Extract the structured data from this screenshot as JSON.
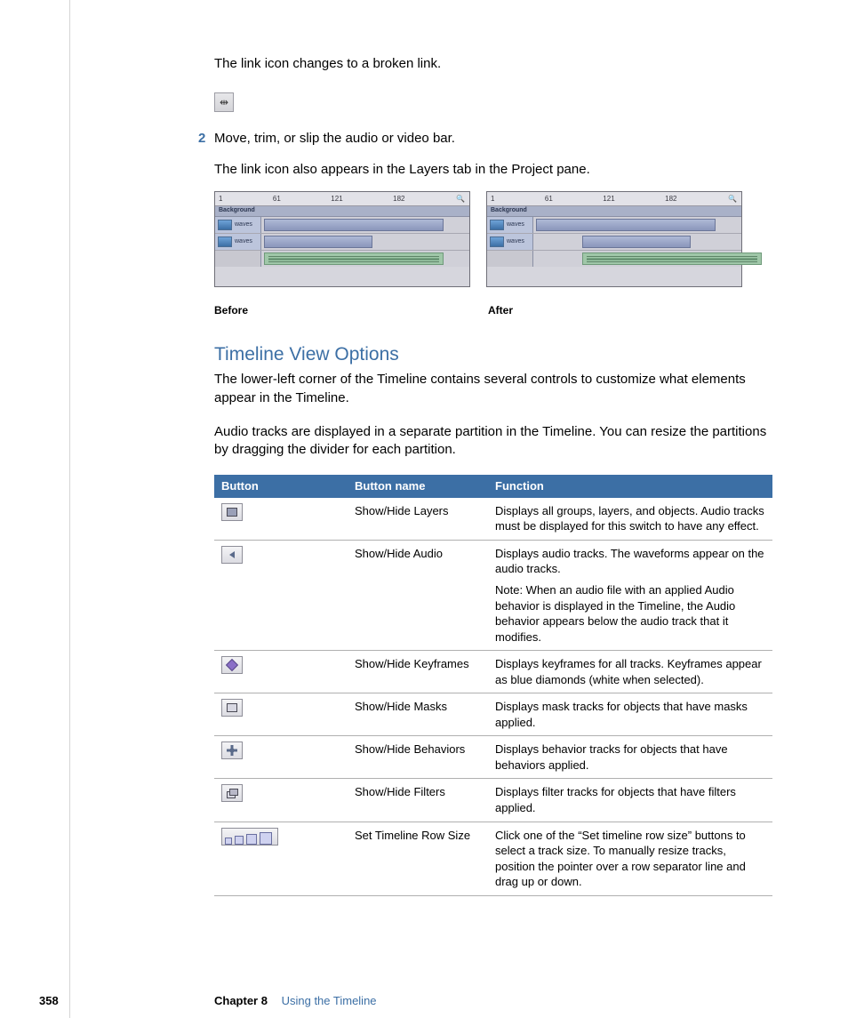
{
  "intro": {
    "line1": "The link icon changes to a broken link.",
    "step_number": "2",
    "step_text": "Move, trim, or slip the audio or video bar.",
    "line2": "The link icon also appears in the Layers tab in the Project pane.",
    "ruler_ticks": [
      "1",
      "61",
      "121",
      "182"
    ],
    "track_label_bg": "Background",
    "track_name": "waves",
    "caption_before": "Before",
    "caption_after": "After"
  },
  "heading": "Timeline View Options",
  "para1": "The lower-left corner of the Timeline contains several controls to customize what elements appear in the Timeline.",
  "para2": "Audio tracks are displayed in a separate partition in the Timeline. You can resize the partitions by dragging the divider for each partition.",
  "table": {
    "headers": [
      "Button",
      "Button name",
      "Function"
    ],
    "rows": [
      {
        "icon": "layers",
        "name": "Show/Hide Layers",
        "function": "Displays all groups, layers, and objects. Audio tracks must be displayed for this switch to have any effect."
      },
      {
        "icon": "audio",
        "name": "Show/Hide Audio",
        "function": "Displays audio tracks. The waveforms appear on the audio tracks.",
        "function_note": "Note: When an audio file with an applied Audio behavior is displayed in the Timeline, the Audio behavior appears below the audio track that it modifies."
      },
      {
        "icon": "keyframes",
        "name": "Show/Hide Keyframes",
        "function": "Displays keyframes for all tracks. Keyframes appear as blue diamonds (white when selected)."
      },
      {
        "icon": "masks",
        "name": "Show/Hide Masks",
        "function": "Displays mask tracks for objects that have masks applied."
      },
      {
        "icon": "behaviors",
        "name": "Show/Hide Behaviors",
        "function": "Displays behavior tracks for objects that have behaviors applied."
      },
      {
        "icon": "filters",
        "name": "Show/Hide Filters",
        "function": "Displays filter tracks for objects that have filters applied."
      },
      {
        "icon": "rowsize",
        "name": "Set Timeline Row Size",
        "function": "Click one of the “Set timeline row size” buttons to select a track size. To manually resize tracks, position the pointer over a row separator line and drag up or down."
      }
    ]
  },
  "footer": {
    "page": "358",
    "chapter_label": "Chapter 8",
    "chapter_title": "Using the Timeline"
  }
}
